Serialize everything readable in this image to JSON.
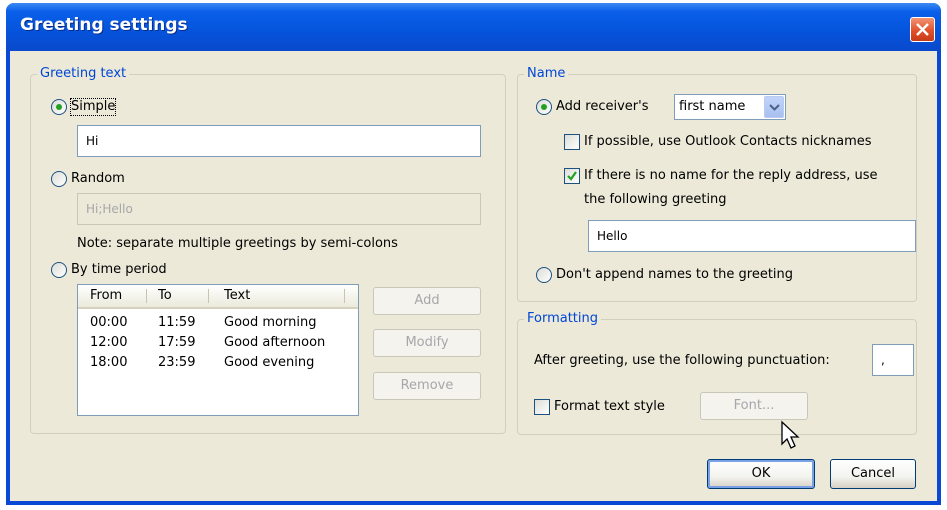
{
  "window": {
    "title": "Greeting settings"
  },
  "greeting_text": {
    "group_label": "Greeting text",
    "simple": {
      "label": "Simple",
      "selected": true,
      "value": "Hi"
    },
    "random": {
      "label": "Random",
      "selected": false,
      "value": "Hi;Hello"
    },
    "note": "Note: separate multiple greetings by semi-colons",
    "by_time_period": {
      "label": "By time period",
      "selected": false,
      "columns": [
        "From",
        "To",
        "Text"
      ],
      "rows": [
        [
          "00:00",
          "11:59",
          "Good morning"
        ],
        [
          "12:00",
          "17:59",
          "Good afternoon"
        ],
        [
          "18:00",
          "23:59",
          "Good evening"
        ]
      ],
      "add_label": "Add",
      "modify_label": "Modify",
      "remove_label": "Remove"
    }
  },
  "name": {
    "group_label": "Name",
    "add_receivers": {
      "label": "Add receiver's",
      "selected": true
    },
    "name_format": {
      "value": "first name"
    },
    "use_nicknames": {
      "label": "If possible, use Outlook Contacts nicknames",
      "checked": false
    },
    "no_name": {
      "label_line1": "If there is no name for the reply address, use",
      "label_line2": "the following greeting",
      "checked": true,
      "value": "Hello"
    },
    "dont_append": {
      "label": "Don't append names to the greeting",
      "selected": false
    }
  },
  "formatting": {
    "group_label": "Formatting",
    "punctuation_label": "After greeting, use the following punctuation:",
    "punctuation_value": ",",
    "format_style": {
      "label": "Format text style",
      "checked": false
    },
    "font_label": "Font..."
  },
  "footer": {
    "ok_label": "OK",
    "cancel_label": "Cancel"
  },
  "colors": {
    "titlebar": "#0553db",
    "dialog_bg": "#ece9d8",
    "group_label": "#0046d5",
    "close": "#e0522c"
  }
}
